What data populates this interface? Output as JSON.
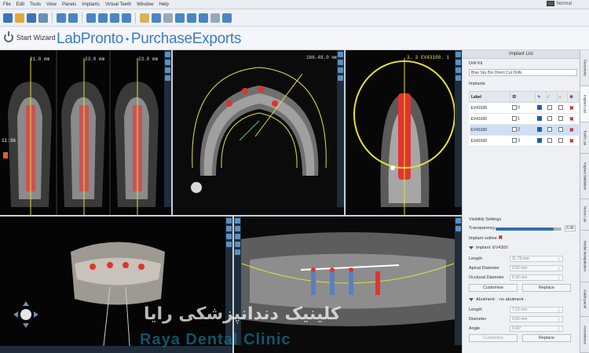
{
  "menu": {
    "items": [
      "File",
      "Edit",
      "Tools",
      "View",
      "Panels",
      "Implants",
      "Virtual Teeth",
      "Window",
      "Help"
    ],
    "view_mode": "Normal"
  },
  "wizard": {
    "start_label": "Start Wizard"
  },
  "brand": {
    "name_1": "LabPronto",
    "name_2": "PurchaseExports"
  },
  "viewports": {
    "slices": {
      "label_a": "21.0 mm",
      "label_b": "23.0 mm",
      "label_c": "23.0 mm",
      "time": "11:36"
    },
    "axial": {
      "label": "166.48.0 mm"
    },
    "cross": {
      "label": "3. 3 EV43100. 1"
    }
  },
  "panel": {
    "title": "Implant List",
    "drill_kit_label": "Drill Kit",
    "drill_kit_value": "Blue Sky Bio Direct Cut Drills",
    "implants_label": "Implants",
    "table_headers": [
      "Label",
      "ID"
    ],
    "implants": [
      {
        "label": "EV43100",
        "id": "0"
      },
      {
        "label": "EV43100",
        "id": "1"
      },
      {
        "label": "EV43100",
        "id": "2"
      },
      {
        "label": "EV43100",
        "id": "3"
      }
    ],
    "visibility_label": "Visibility Settings",
    "transparency_label": "Transparency",
    "transparency_value": "0.36",
    "transparency_level": 0.88,
    "implant_outline_label": "Implant outline",
    "implant_section": "Implant: EV4300",
    "length_label": "Length",
    "length_value": "11.79 mm",
    "apical_label": "Apical Diameter",
    "apical_value": "2.50 mm",
    "occlusal_label": "Occlusal Diameter",
    "occlusal_value": "4.30 mm",
    "customise_label": "Customise",
    "replace_label": "Replace",
    "abutment_section": "Abutment: - no abutment -",
    "ab_length_label": "Length",
    "ab_length_value": "7.13 mm",
    "ab_diameter_label": "Diameter",
    "ab_diameter_value": "4.50 mm",
    "ab_angle_label": "Angle",
    "ab_angle_value": "0.00°",
    "ab_customise_label": "Customise",
    "ab_replace_label": "Replace"
  },
  "tabs": [
    "Panoramic",
    "Implant List",
    "Tooth List",
    "Implant Validation",
    "Nerve List",
    "Model Manipulation",
    "Guide panel",
    "Annotations"
  ],
  "watermark": {
    "fa": "کلینیک دندانپزشکی رایا",
    "en": "Raya Dental Clinic"
  },
  "colors": {
    "brand": "#3d7cc0",
    "implant_red": "#e0342f",
    "delete_red": "#c0282d",
    "curve_yellow": "#e3e03a"
  }
}
